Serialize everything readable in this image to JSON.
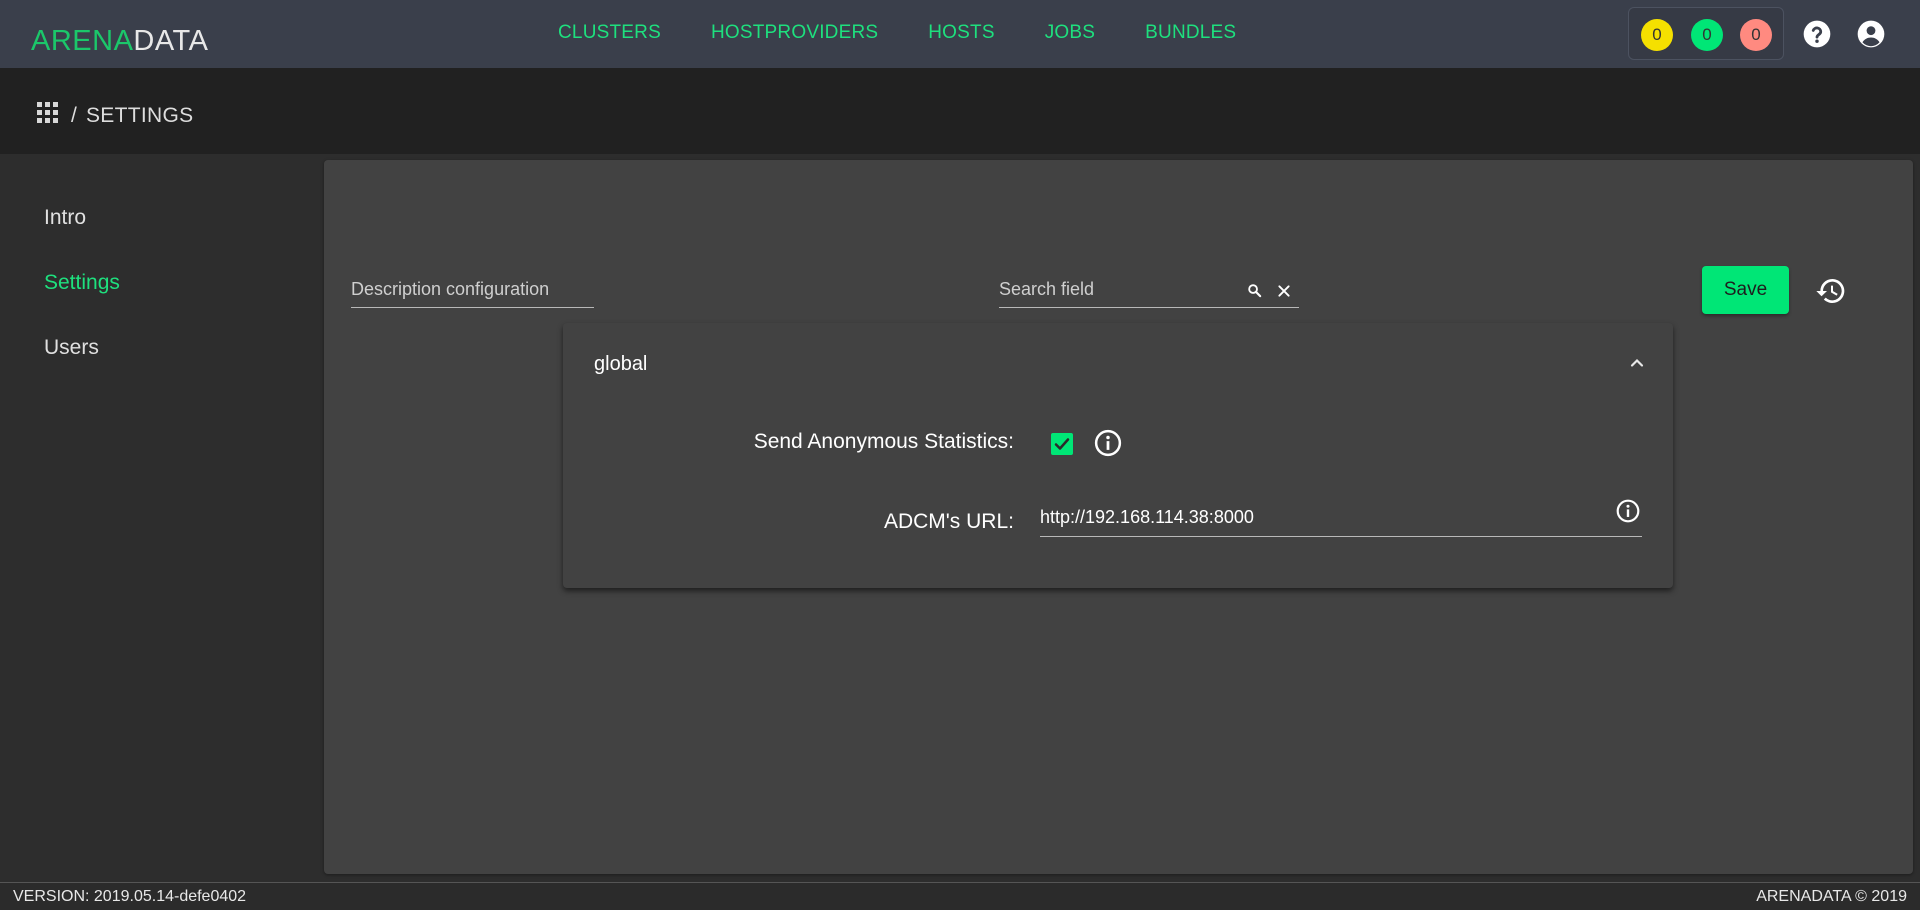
{
  "brand": {
    "logo_part1": "ARENA",
    "logo_part2": "DATA",
    "accent_color": "#1ee07e"
  },
  "nav": {
    "items": [
      {
        "label": "CLUSTERS"
      },
      {
        "label": "HOSTPROVIDERS"
      },
      {
        "label": "HOSTS"
      },
      {
        "label": "JOBS"
      },
      {
        "label": "BUNDLES"
      }
    ]
  },
  "counters": [
    {
      "value": "0",
      "color": "#f5e000"
    },
    {
      "value": "0",
      "color": "#00e676"
    },
    {
      "value": "0",
      "color": "#ff8a80"
    }
  ],
  "header_icons": [
    "help-icon",
    "account-icon"
  ],
  "breadcrumb": {
    "icon": "apps-grid-icon",
    "separator": "/",
    "current": "SETTINGS"
  },
  "sidebar": {
    "items": [
      {
        "label": "Intro",
        "active": false
      },
      {
        "label": "Settings",
        "active": true
      },
      {
        "label": "Users",
        "active": false
      }
    ]
  },
  "toolbar": {
    "description_placeholder": "Description configuration",
    "search_placeholder": "Search field",
    "save_label": "Save",
    "history_icon": "history-icon"
  },
  "config_group": {
    "title": "global",
    "expanded": true,
    "fields": [
      {
        "label": "Send Anonymous Statistics:",
        "type": "checkbox",
        "checked": true
      },
      {
        "label": "ADCM's URL:",
        "type": "text",
        "value": "http://192.168.114.38:8000"
      }
    ]
  },
  "footer": {
    "version": "VERSION: 2019.05.14-defe0402",
    "copyright": "ARENADATA © 2019"
  }
}
